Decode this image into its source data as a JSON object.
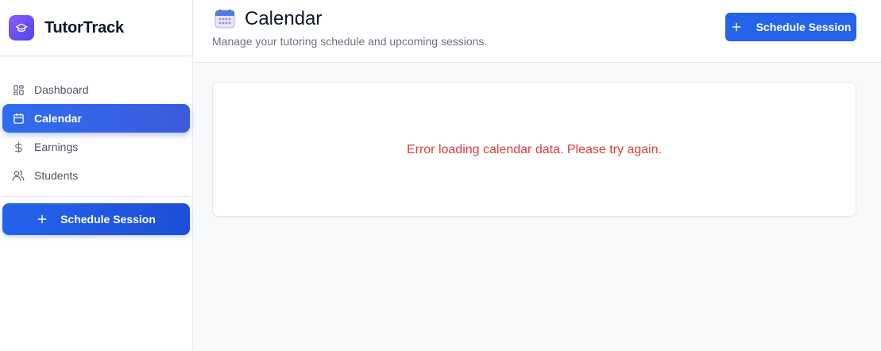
{
  "app": {
    "name": "TutorTrack"
  },
  "sidebar": {
    "items": [
      {
        "label": "Dashboard",
        "icon": "dashboard-icon",
        "active": false
      },
      {
        "label": "Calendar",
        "icon": "calendar-icon",
        "active": true
      },
      {
        "label": "Earnings",
        "icon": "dollar-icon",
        "active": false
      },
      {
        "label": "Students",
        "icon": "users-icon",
        "active": false
      }
    ],
    "schedule_button": "Schedule Session"
  },
  "header": {
    "title": "Calendar",
    "subtitle": "Manage your tutoring schedule and upcoming sessions.",
    "schedule_button": "Schedule Session"
  },
  "main": {
    "error_message": "Error loading calendar data. Please try again."
  },
  "colors": {
    "accent": "#2563eb",
    "error": "#dc3c3c",
    "brand_gradient_start": "#8b5cf6",
    "brand_gradient_end": "#4f46e5"
  }
}
